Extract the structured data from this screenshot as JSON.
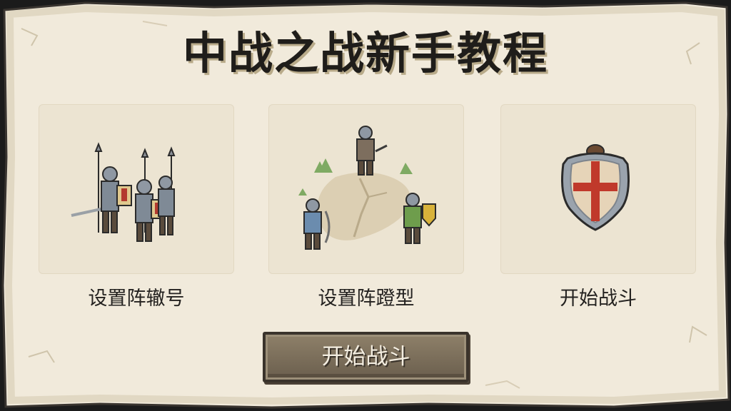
{
  "title": "中战之战新手教程",
  "cards": [
    {
      "label": "设置阵辙号",
      "image_icon": "spearmen-squad-icon"
    },
    {
      "label": "设置阵蹬型",
      "image_icon": "formation-map-icon"
    },
    {
      "label": "开始战斗",
      "image_icon": "crusader-shield-icon"
    }
  ],
  "start_button": {
    "label": "开始战斗"
  },
  "colors": {
    "parchment": "#f2ecdc",
    "card": "#ece4d2",
    "button": "#7a6d59",
    "title_text": "#1f1d1a"
  }
}
